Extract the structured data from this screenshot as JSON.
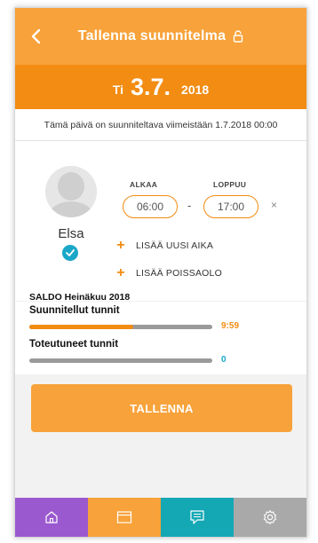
{
  "header": {
    "title": "Tallenna suunnitelma",
    "back_icon": "chevron-left-icon",
    "lock_icon": "lock-open-icon",
    "bg": "#f7a23a"
  },
  "date": {
    "weekday": "Ti",
    "day": "3.7.",
    "year": "2018",
    "bg": "#f28c12"
  },
  "deadline_text": "Tämä päivä on suunniteltava viimeistään 1.7.2018 00:00",
  "employee": {
    "name": "Elsa",
    "avatar_icon": "person-placeholder-icon",
    "check_icon": "checkmark-icon"
  },
  "time": {
    "start_label": "ALKAA",
    "end_label": "LOPPUU",
    "start_value": "06:00",
    "end_value": "17:00",
    "separator": "-",
    "remove": "×"
  },
  "actions": {
    "add_time": "LISÄÄ UUSI AIKA",
    "add_absence": "LISÄÄ POISSAOLO",
    "plus": "+"
  },
  "saldo": {
    "title": "SALDO  Heinäkuu 2018",
    "planned_label": "Suunnitellut tunnit",
    "planned_value": "9:59",
    "planned_fraction": 0.57,
    "planned_color": "#f28c12",
    "actual_label": "Toteutuneet tunnit",
    "actual_value": "0",
    "actual_fraction": 0,
    "actual_color": "#1aa7c8"
  },
  "save_label": "TALLENNA",
  "tabs": [
    {
      "icon": "home-icon",
      "color": "#9b59d0"
    },
    {
      "icon": "calendar-icon",
      "color": "#f7a23a"
    },
    {
      "icon": "message-icon",
      "color": "#14a8b5"
    },
    {
      "icon": "gear-icon",
      "color": "#a9a9a9"
    }
  ]
}
